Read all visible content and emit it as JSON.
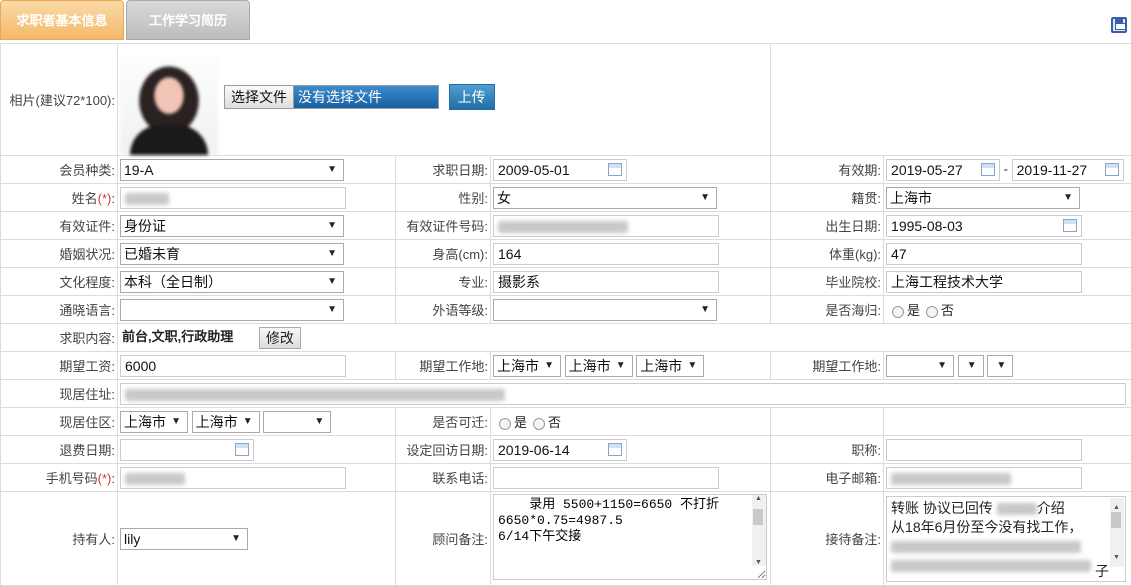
{
  "tabs": {
    "basic": "求职者基本信息",
    "work": "工作学习简历"
  },
  "photo": {
    "label": "相片(建议72*100):",
    "choose_file": "选择文件",
    "no_file": "没有选择文件",
    "upload": "上传"
  },
  "row_member": {
    "label": "会员种类:",
    "value": "19-A",
    "apply_label": "求职日期:",
    "apply_value": "2009-05-01",
    "valid_label": "有效期:",
    "valid_from": "2019-05-27",
    "sep": "-",
    "valid_to": "2019-11-27"
  },
  "row_name": {
    "label": "姓名",
    "req": "(*)",
    "colon": ":",
    "gender_label": "性别:",
    "gender_value": "女",
    "native_label": "籍贯:",
    "native_value": "上海市"
  },
  "row_id": {
    "label": "有效证件:",
    "value": "身份证",
    "idno_label": "有效证件号码:",
    "birth_label": "出生日期:",
    "birth_value": "1995-08-03"
  },
  "row_marital": {
    "label": "婚姻状况:",
    "value": "已婚未育",
    "height_label": "身高(cm):",
    "height_value": "164",
    "weight_label": "体重(kg):",
    "weight_value": "47"
  },
  "row_edu": {
    "label": "文化程度:",
    "value": "本科（全日制）",
    "major_label": "专业:",
    "major_value": "摄影系",
    "school_label": "毕业院校:",
    "school_value": "上海工程技术大学"
  },
  "row_lang": {
    "label": "通晓语言:",
    "value": "",
    "fl_label": "外语等级:",
    "fl_value": "",
    "overseas_label": "是否海归:",
    "yes": "是",
    "no": "否"
  },
  "row_job": {
    "label": "求职内容:",
    "value": "前台,文职,行政助理",
    "edit": "修改"
  },
  "row_salary": {
    "label": "期望工资:",
    "value": "6000",
    "loc_label": "期望工作地:",
    "loc1": "上海市",
    "loc2": "上海市",
    "loc3": "上海市",
    "loc2_label": "期望工作地:"
  },
  "row_addr": {
    "label": "现居住址:"
  },
  "row_area": {
    "label": "现居住区:",
    "a1": "上海市",
    "a2": "上海市",
    "a3": "",
    "move_label": "是否可迁:",
    "yes": "是",
    "no": "否"
  },
  "row_refund": {
    "label": "退费日期:",
    "value": "",
    "visit_label": "设定回访日期:",
    "visit_value": "2019-06-14",
    "title_label": "职称:",
    "title_value": ""
  },
  "row_phone": {
    "label": "手机号码",
    "req": "(*)",
    "colon": ":",
    "tel_label": "联系电话:",
    "email_label": "电子邮箱:"
  },
  "row_owner": {
    "label": "持有人:",
    "value": "lily",
    "advisor_label": "顾问备注:",
    "advisor_note": "    录用 5500+1150=6650 不打折\n6650*0.75=4987.5\n6/14下午交接",
    "reception_label": "接待备注:",
    "reception_line1": "转账  协议已回传",
    "reception_line1b": "介绍",
    "reception_line2": "从18年6月份至今没有找工作，",
    "reception_tail": "子"
  }
}
